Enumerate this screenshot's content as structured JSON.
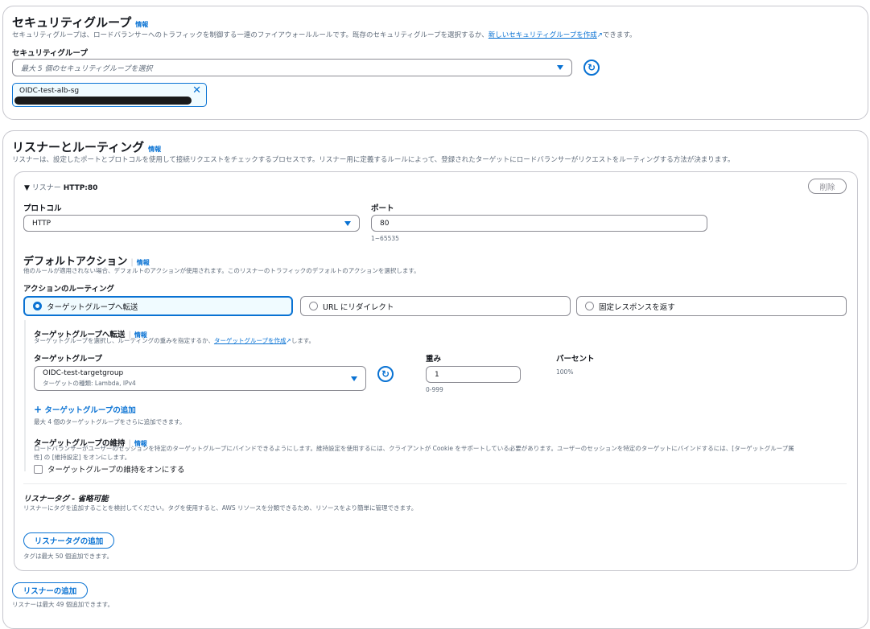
{
  "security_group": {
    "title": "セキュリティグループ",
    "info": "情報",
    "description_pre": "セキュリティグループは、ロードバランサーへのトラフィックを制御する一連のファイアウォールルールです。既存のセキュリティグループを選択するか、",
    "description_link": "新しいセキュリティグループを作成",
    "description_post": "できます。",
    "field_label": "セキュリティグループ",
    "placeholder": "最大 5 個のセキュリティグループを選択",
    "selected_token": {
      "name": "OIDC-test-alb-sg"
    }
  },
  "listeners": {
    "title": "リスナーとルーティング",
    "info": "情報",
    "description": "リスナーは、設定したポートとプロトコルを使用して接続リクエストをチェックするプロセスです。リスナー用に定義するルールによって、登録されたターゲットにロードバランサーがリクエストをルーティングする方法が決まります。",
    "listener": {
      "header_prefix": "リスナー",
      "header_name": "HTTP:80",
      "remove_label": "削除",
      "protocol_label": "プロトコル",
      "protocol_value": "HTTP",
      "port_label": "ポート",
      "port_value": "80",
      "port_hint": "1~65535",
      "default_action": {
        "title": "デフォルトアクション",
        "info": "情報",
        "description": "他のルールが適用されない場合、デフォルトのアクションが使用されます。このリスナーのトラフィックのデフォルトのアクションを選択します。"
      },
      "routing_label": "アクションのルーティング",
      "routing_options": [
        {
          "label": "ターゲットグループへ転送",
          "selected": true
        },
        {
          "label": "URL にリダイレクト",
          "selected": false
        },
        {
          "label": "固定レスポンスを返す",
          "selected": false
        }
      ],
      "forward": {
        "title": "ターゲットグループへ転送",
        "info": "情報",
        "desc_pre": "ターゲットグループを選択し、ルーティングの重みを指定するか、",
        "desc_link": "ターゲットグループを作成",
        "desc_post": "します。",
        "tg_label": "ターゲットグループ",
        "tg_value": "OIDC-test-targetgroup",
        "tg_sub": "ターゲットの種類: Lambda, IPv4",
        "weight_label": "重み",
        "weight_value": "1",
        "weight_hint": "0-999",
        "percent_label": "パーセント",
        "percent_value": "100%",
        "add_tg": "ターゲットグループの追加",
        "add_tg_hint": "最大 4 個のターゲットグループをさらに追加できます。",
        "stickiness_title": "ターゲットグループの維持",
        "stickiness_info": "情報",
        "stickiness_desc1": "ロードバランサーがユーザーのセッションを特定のターゲットグループにバインドできるようにします。維持設定を使用するには、クライアントが Cookie をサポートしている必要があります。ユーザーのセッションを特定のターゲットにバインドするには、[ターゲットグループ属",
        "stickiness_desc2": "性] の [維持設定] をオンにします。",
        "stickiness_checkbox": "ターゲットグループの維持をオンにする"
      },
      "tags": {
        "title": "リスナータグ - ",
        "title_opt": "省略可能",
        "description": "リスナーにタグを追加することを検討してください。タグを使用すると、AWS リソースを分類できるため、リソースをより簡単に管理できます。",
        "add_button": "リスナータグの追加",
        "hint": "タグは最大 50 個追加できます。"
      }
    },
    "add_listener": "リスナーの追加",
    "add_listener_hint": "リスナーは最大 49 個追加できます。"
  }
}
